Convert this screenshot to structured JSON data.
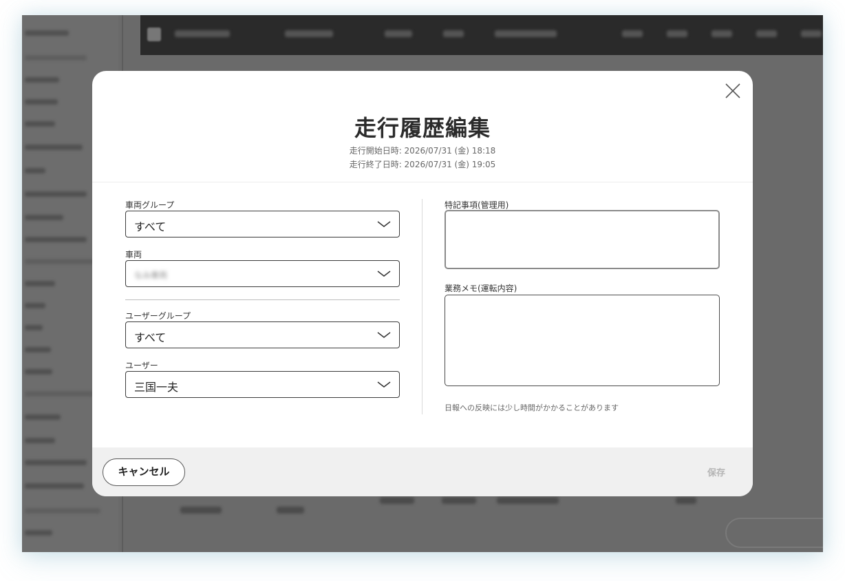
{
  "modal": {
    "title": "走行履歴編集",
    "start_datetime": "走行開始日時: 2026/07/31 (金) 18:18",
    "end_datetime": "走行終了日時: 2026/07/31 (金) 19:05",
    "close_icon": "close-icon"
  },
  "left": {
    "vehicle_group": {
      "label": "車両グループ",
      "value": "すべて"
    },
    "vehicle": {
      "label": "車両",
      "value": "なみ車両"
    },
    "user_group": {
      "label": "ユーザーグループ",
      "value": "すべて"
    },
    "user": {
      "label": "ユーザー",
      "value": "三国一夫"
    }
  },
  "right": {
    "admin_notes": {
      "label": "特記事項(管理用)",
      "value": ""
    },
    "work_memo": {
      "label": "業務メモ(運転内容)",
      "value": ""
    },
    "hint": "日報への反映には少し時間がかかることがあります"
  },
  "footer": {
    "cancel_label": "キャンセル",
    "save_label": "保存"
  }
}
